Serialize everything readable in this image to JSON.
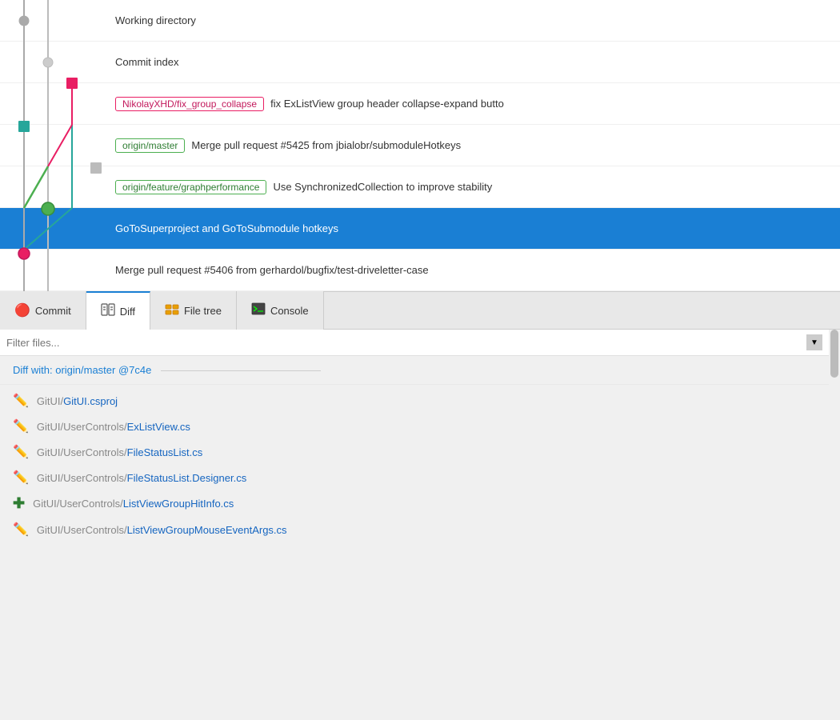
{
  "colors": {
    "selected_bg": "#1a7fd4",
    "accent_blue": "#1a7fd4",
    "green": "#4caf50",
    "pink": "#e91e63",
    "orange": "#ff9800"
  },
  "commits": [
    {
      "id": "working-directory",
      "label": "Working directory",
      "tag": null,
      "selected": false,
      "graph_type": "working"
    },
    {
      "id": "commit-index",
      "label": "Commit index",
      "tag": null,
      "selected": false,
      "graph_type": "index"
    },
    {
      "id": "fix-group-collapse",
      "tag": "NikolayXHD/fix_group_collapse",
      "tag_color": "pink",
      "message": "fix ExListView group header collapse-expand butto",
      "selected": false,
      "graph_type": "branch1"
    },
    {
      "id": "origin-master",
      "tag": "origin/master",
      "tag_color": "green",
      "message": "Merge pull request #5425 from jbialobr/submoduleHotkeys",
      "selected": false,
      "graph_type": "branch2"
    },
    {
      "id": "origin-feature-graphperf",
      "tag": "origin/feature/graphperformance",
      "tag_color": "green",
      "message": "Use SynchronizedCollection to improve stability",
      "selected": false,
      "graph_type": "branch3"
    },
    {
      "id": "goto-superproject",
      "tag": null,
      "message": "GoToSuperproject and GoToSubmodule hotkeys",
      "selected": true,
      "graph_type": "branch4"
    },
    {
      "id": "merge-pr-5406",
      "tag": null,
      "message": "Merge pull request #5406 from gerhardol/bugfix/test-driveletter-case",
      "selected": false,
      "graph_type": "branch5"
    }
  ],
  "tabs": [
    {
      "id": "commit",
      "label": "Commit",
      "icon": "🔴",
      "active": false
    },
    {
      "id": "diff",
      "label": "Diff",
      "icon": "📋",
      "active": true
    },
    {
      "id": "file-tree",
      "label": "File tree",
      "icon": "📁",
      "active": false
    },
    {
      "id": "console",
      "label": "Console",
      "icon": "🖥",
      "active": false
    }
  ],
  "filter": {
    "placeholder": "Filter files..."
  },
  "diff_header": "Diff with: origin/master @7c4e",
  "files": [
    {
      "icon": "✏️",
      "icon_type": "edit",
      "path_prefix": "GitUI/",
      "path_name": "GitUI.csproj"
    },
    {
      "icon": "✏️",
      "icon_type": "edit",
      "path_prefix": "GitUI/UserControls/",
      "path_name": "ExListView.cs"
    },
    {
      "icon": "✏️",
      "icon_type": "edit",
      "path_prefix": "GitUI/UserControls/",
      "path_name": "FileStatusList.cs"
    },
    {
      "icon": "✏️",
      "icon_type": "edit",
      "path_prefix": "GitUI/UserControls/",
      "path_name": "FileStatusList.Designer.cs"
    },
    {
      "icon": "➕",
      "icon_type": "add",
      "path_prefix": "GitUI/UserControls/",
      "path_name": "ListViewGroupHitInfo.cs"
    },
    {
      "icon": "✏️",
      "icon_type": "edit",
      "path_prefix": "GitUI/UserControls/",
      "path_name": "ListViewGroupMouseEventArgs.cs"
    }
  ]
}
